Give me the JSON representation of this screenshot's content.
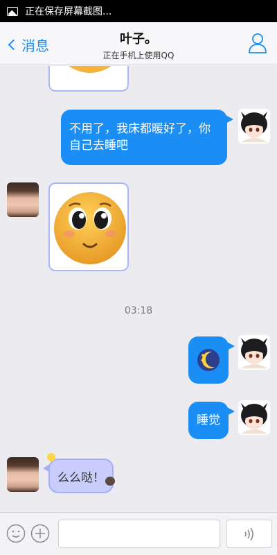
{
  "status_bar": {
    "text": "正在保存屏幕截图..."
  },
  "header": {
    "back_label": "消息",
    "title": "叶子。",
    "subtitle": "正在手机上使用QQ"
  },
  "messages": {
    "m1_text": "不用了，我床都暖好了，你自己去睡吧",
    "time": "03:18",
    "m4_text": "睡觉",
    "m5_text": "么么哒！"
  },
  "input": {
    "placeholder": ""
  },
  "colors": {
    "accent": "#1a8ef5",
    "bubble_purple": "#c9cdfc",
    "background": "#ebebf0"
  },
  "icons": {
    "status": "image-icon",
    "back": "chevron-left-icon",
    "profile": "person-icon",
    "emoji": "smiley-icon",
    "plus": "plus-icon",
    "voice": "voice-wave-icon",
    "moon": "moon-icon"
  }
}
